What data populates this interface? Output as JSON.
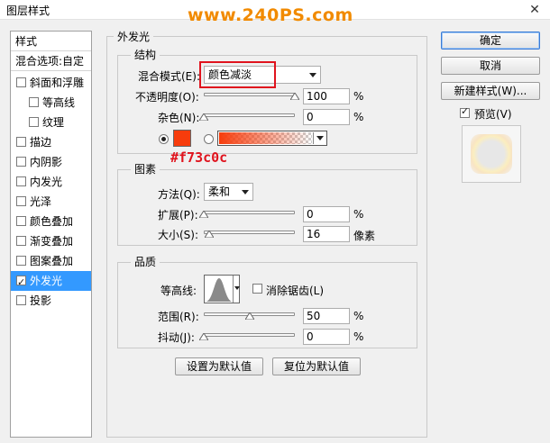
{
  "dialog": {
    "title": "图层样式",
    "close_glyph": "✕"
  },
  "watermark": "www.240PS.com",
  "left_list": {
    "header_styles": "样式",
    "header_blend": "混合选项:自定",
    "items": [
      {
        "label": "斜面和浮雕",
        "checked": false
      },
      {
        "label": "等高线",
        "checked": false
      },
      {
        "label": "纹理",
        "checked": false
      },
      {
        "label": "描边",
        "checked": false
      },
      {
        "label": "内阴影",
        "checked": false
      },
      {
        "label": "内发光",
        "checked": false
      },
      {
        "label": "光泽",
        "checked": false
      },
      {
        "label": "颜色叠加",
        "checked": false
      },
      {
        "label": "渐变叠加",
        "checked": false
      },
      {
        "label": "图案叠加",
        "checked": false
      },
      {
        "label": "外发光",
        "checked": true,
        "selected": true
      },
      {
        "label": "投影",
        "checked": false
      }
    ]
  },
  "outer_glow": {
    "title": "外发光",
    "structure": {
      "title": "结构",
      "blend_mode_label": "混合模式(E):",
      "blend_mode_value": "颜色减淡",
      "opacity_label": "不透明度(O):",
      "opacity_value": "100",
      "opacity_unit": "%",
      "opacity_level": 1.0,
      "noise_label": "杂色(N):",
      "noise_value": "0",
      "noise_unit": "%",
      "noise_level": 0.0,
      "color_hex_annotation": "#f73c0c",
      "glow_color": "#f73c0c"
    },
    "elements": {
      "title": "图素",
      "technique_label": "方法(Q):",
      "technique_value": "柔和",
      "spread_label": "扩展(P):",
      "spread_value": "0",
      "spread_unit": "%",
      "spread_level": 0.0,
      "size_label": "大小(S):",
      "size_value": "16",
      "size_unit": "像素",
      "size_level": 0.064
    },
    "quality": {
      "title": "品质",
      "contour_label": "等高线:",
      "antialias_label": "消除锯齿(L)",
      "antialias_checked": false,
      "range_label": "范围(R):",
      "range_value": "50",
      "range_unit": "%",
      "range_level": 0.5,
      "jitter_label": "抖动(J):",
      "jitter_value": "0",
      "jitter_unit": "%",
      "jitter_level": 0.0
    },
    "make_default": "设置为默认值",
    "reset_default": "复位为默认值"
  },
  "right_panel": {
    "ok": "确定",
    "cancel": "取消",
    "new_style": "新建样式(W)...",
    "preview_label": "预览(V)",
    "preview_checked": true
  },
  "colors": {
    "selection": "#3399ff",
    "annotation_red": "#e0141e",
    "watermark": "#f18a00",
    "glow": "#f73c0c"
  }
}
